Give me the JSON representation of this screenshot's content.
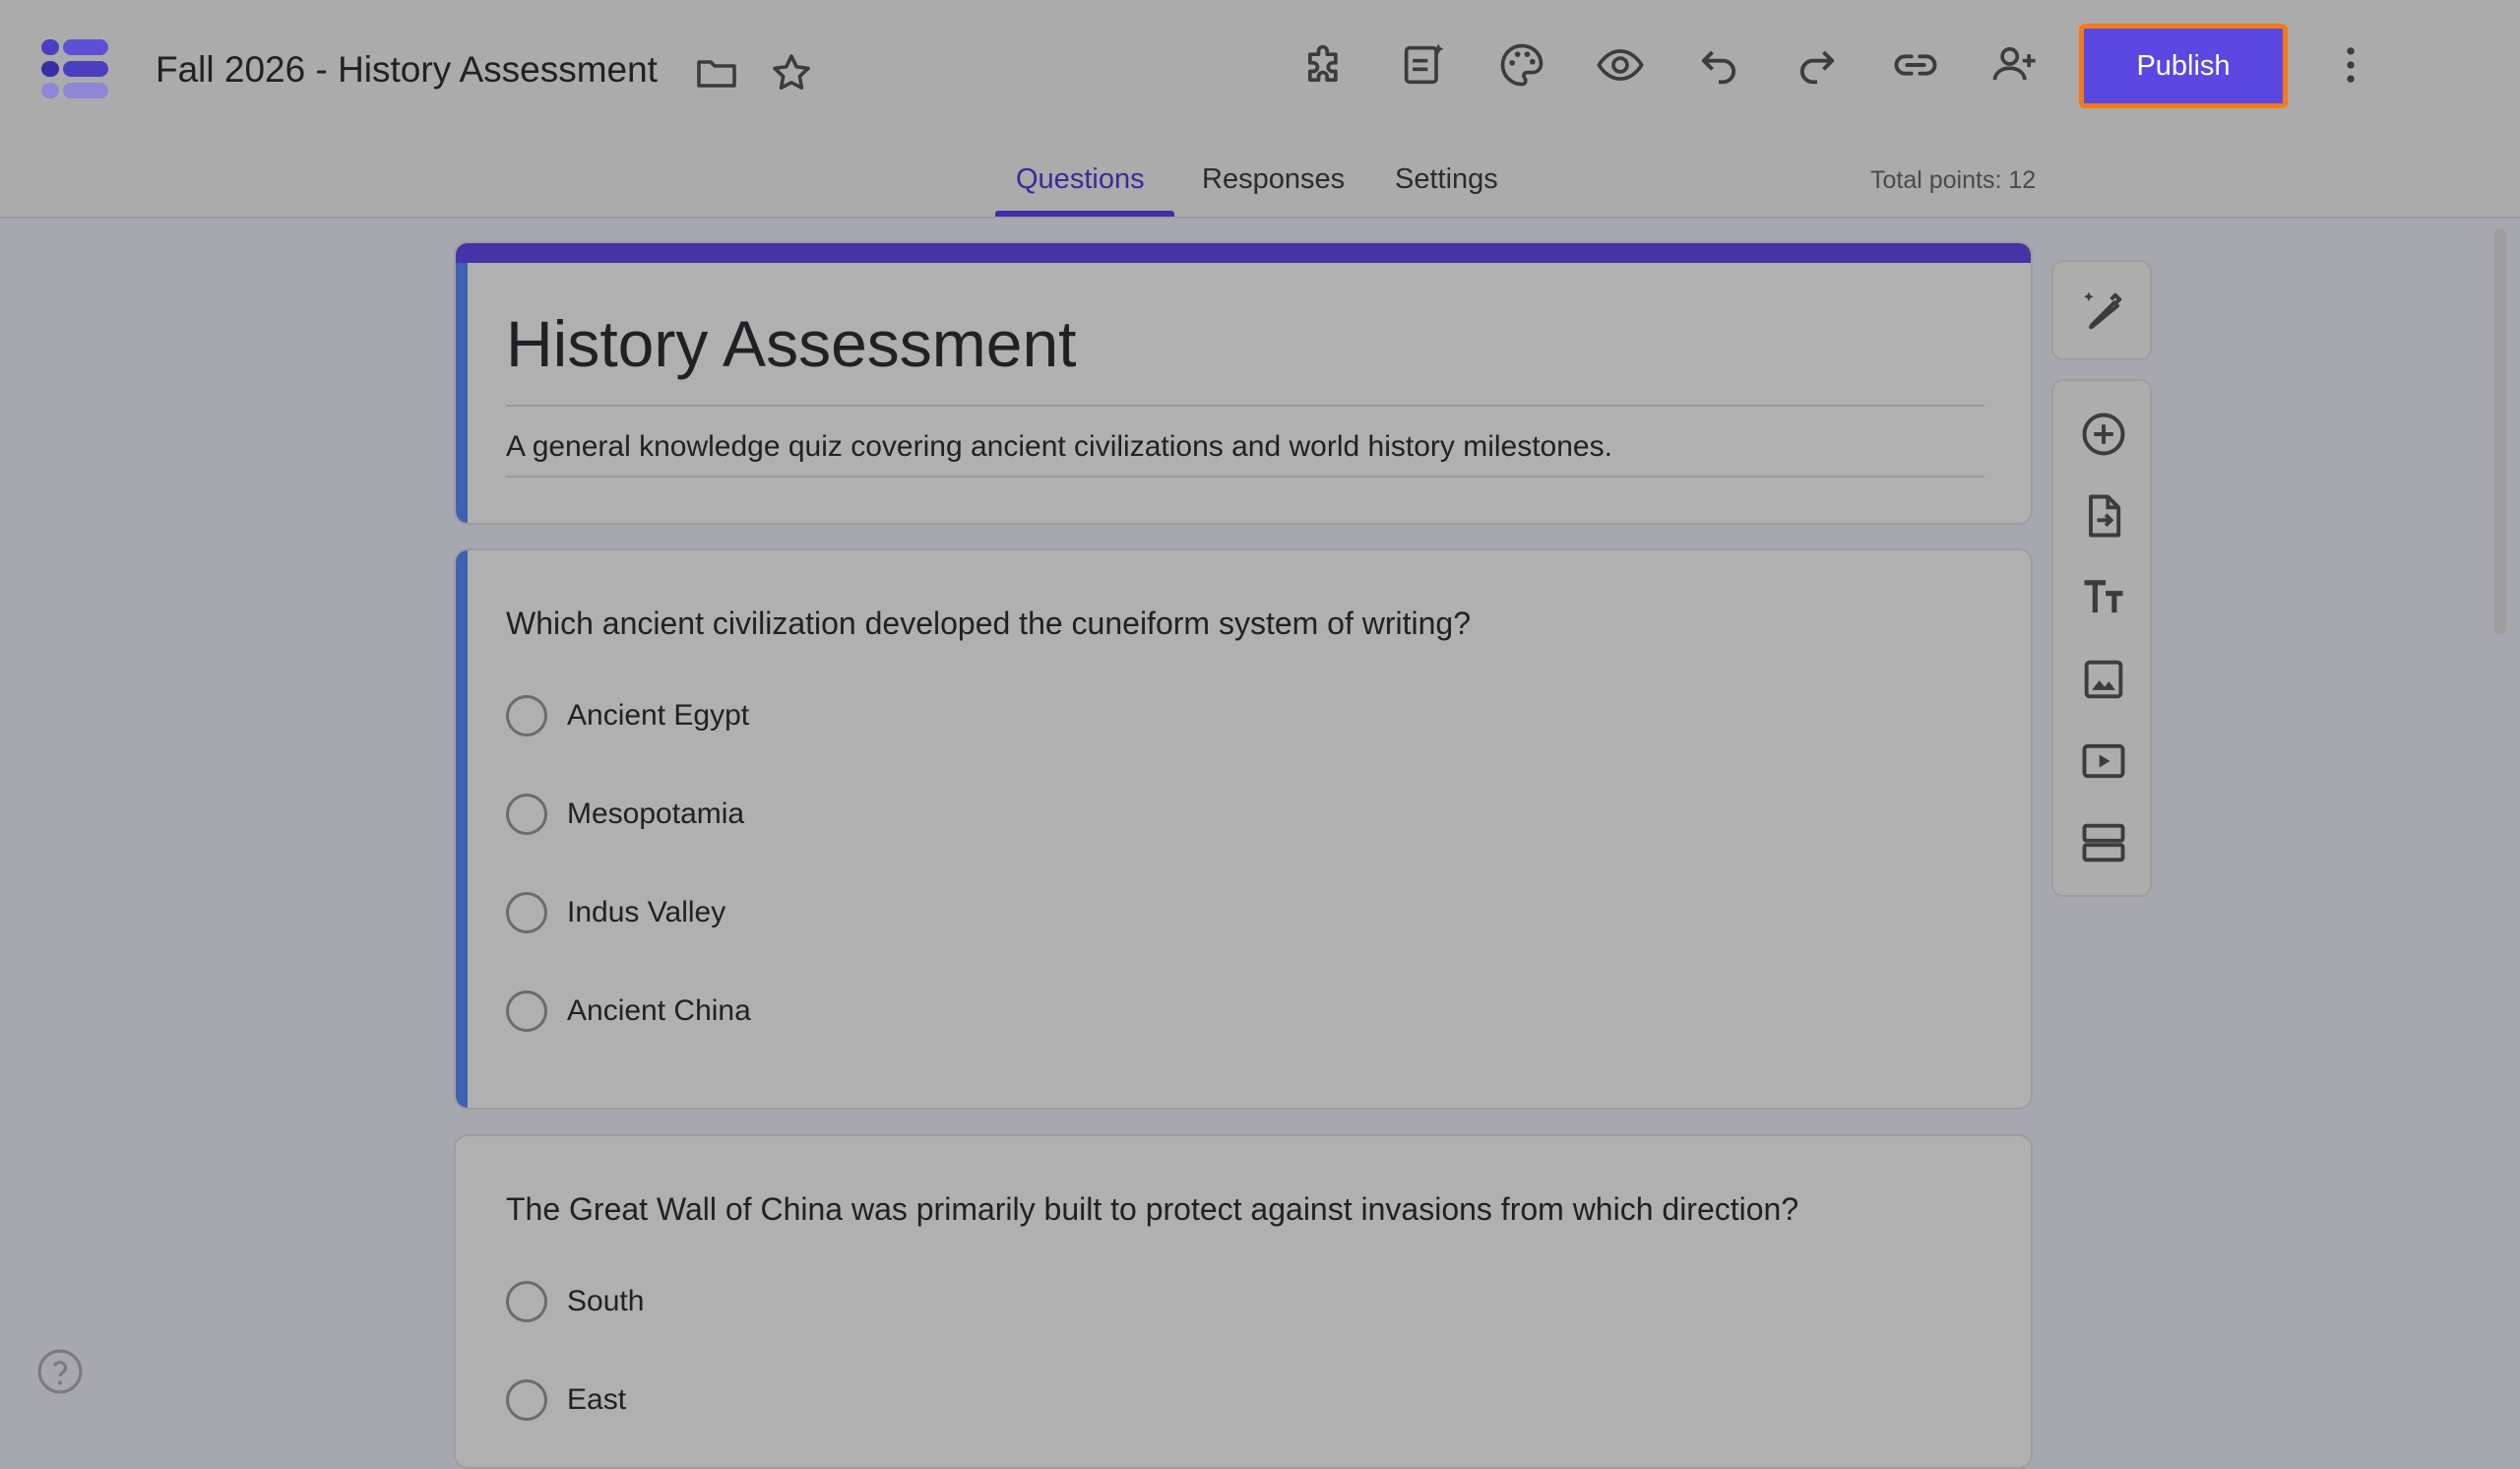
{
  "header": {
    "doc_title": "Fall 2026 - History Assessment",
    "icons": [
      "app-logo-icon",
      "folder-icon",
      "star-icon",
      "addons-icon",
      "ai-form-icon",
      "palette-icon",
      "preview-eye-icon",
      "undo-icon",
      "redo-icon",
      "link-icon",
      "add-collaborator-icon",
      "more-vert-icon"
    ],
    "publish_label": "Publish",
    "publish_color": "#5b48e3",
    "publish_highlight_color": "#f47b16"
  },
  "tabs": [
    {
      "label": "Questions",
      "active": true
    },
    {
      "label": "Responses",
      "active": false
    },
    {
      "label": "Settings",
      "active": false
    }
  ],
  "total_points": "Total points: 12",
  "form": {
    "title": "History Assessment",
    "description": "A general knowledge quiz covering ancient civilizations and world history milestones.",
    "accent_color": "#4434a6"
  },
  "questions": [
    {
      "text": "Which ancient civilization developed the cuneiform system of writing?",
      "options": [
        "Ancient Egypt",
        "Mesopotamia",
        "Indus Valley",
        "Ancient China"
      ]
    },
    {
      "text": "The Great Wall of China was primarily built to protect against invasions from which direction?",
      "options": [
        "South",
        "East"
      ]
    }
  ],
  "side_toolbar": {
    "icons": [
      "ai-edit-icon",
      "add-question-icon",
      "import-questions-icon",
      "add-title-icon",
      "add-image-icon",
      "add-video-icon",
      "add-section-icon"
    ]
  },
  "help_icon": "help-icon"
}
